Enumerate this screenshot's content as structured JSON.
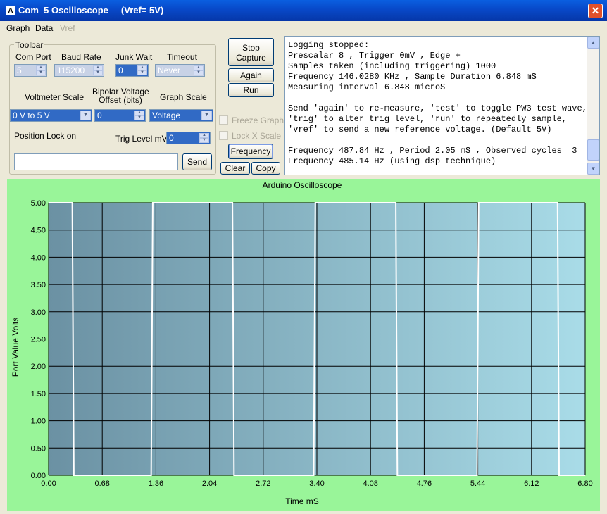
{
  "window": {
    "title": "Com  5 Oscilloscope     (Vref= 5V)",
    "close_icon": "✕"
  },
  "menu": {
    "graph": "Graph",
    "data": "Data",
    "vref": "Vref"
  },
  "toolbar": {
    "legend": "Toolbar",
    "com_port_label": "Com Port",
    "com_port_value": "5",
    "baud_rate_label": "Baud Rate",
    "baud_rate_value": "115200",
    "junk_wait_label": "Junk Wait",
    "junk_wait_value": "0",
    "timeout_label": "Timeout",
    "timeout_value": "Never",
    "voltmeter_scale_label": "Voltmeter Scale",
    "voltmeter_scale_value": "0 V to 5 V",
    "bipolar_label_1": "Bipolar Voltage",
    "bipolar_label_2": "Offset (bits)",
    "bipolar_value": "0",
    "graph_scale_label": "Graph Scale",
    "graph_scale_value": "Voltage",
    "position_lock_label": "Position Lock on",
    "trig_level_label": "Trig Level mV",
    "trig_level_value": "0",
    "send_input_value": "",
    "send_label": "Send"
  },
  "controls": {
    "stop_capture_1": "Stop",
    "stop_capture_2": "Capture",
    "again": "Again",
    "run": "Run",
    "freeze_graph": "Freeze Graph",
    "lock_x_scale": "Lock X Scale",
    "frequency": "Frequency",
    "clear": "Clear",
    "copy": "Copy"
  },
  "log": {
    "lines": [
      "Logging stopped:",
      "Prescalar 8 , Trigger 0mV , Edge +",
      "Samples taken (including triggering) 1000",
      "Frequency 146.0280 KHz , Sample Duration 6.848 mS",
      "Measuring interval 6.848 microS",
      "",
      "Send 'again' to re-measure, 'test' to toggle PW3 test wave,",
      "'trig' to alter trig level, 'run' to repeatedly sample,",
      "'vref' to send a new reference voltage. (Default 5V)",
      "",
      "Frequency 487.84 Hz , Period 2.05 mS , Observed cycles  3",
      "Frequency 485.14 Hz (using dsp technique)"
    ]
  },
  "chart_data": {
    "type": "line",
    "title": "Arduino Oscilloscope",
    "xlabel": "Time mS",
    "ylabel": "Port Value Volts",
    "xlim": [
      0,
      6.8
    ],
    "ylim": [
      0,
      5
    ],
    "grid": true,
    "x_ticks": [
      "0.00",
      "0.68",
      "1.36",
      "2.04",
      "2.72",
      "3.40",
      "4.08",
      "4.76",
      "5.44",
      "6.12",
      "6.80"
    ],
    "y_ticks": [
      "0.00",
      "0.50",
      "1.00",
      "1.50",
      "2.00",
      "2.50",
      "3.00",
      "3.50",
      "4.00",
      "4.50",
      "5.00"
    ],
    "series": [
      {
        "color": "#ffffff",
        "x": [
          0.0,
          0.3,
          0.32,
          1.3,
          1.32,
          2.33,
          2.35,
          3.36,
          3.38,
          4.4,
          4.42,
          5.43,
          5.45,
          6.45,
          6.47,
          6.8
        ],
        "y": [
          5.0,
          5.0,
          0.0,
          0.0,
          5.0,
          5.0,
          0.0,
          0.0,
          5.0,
          5.0,
          0.0,
          0.0,
          5.0,
          5.0,
          0.0,
          0.0
        ]
      }
    ]
  }
}
